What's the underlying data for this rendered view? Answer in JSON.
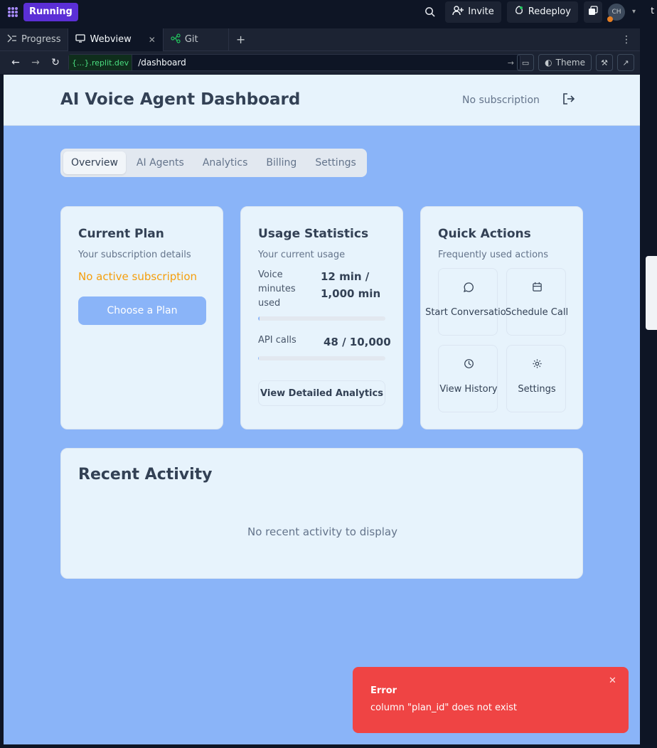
{
  "ide": {
    "status": "Running",
    "invite_label": "Invite",
    "redeploy_label": "Redeploy",
    "avatar_initials": "CH",
    "edge_letter": "t",
    "tabs": [
      {
        "label": "Progress",
        "icon": "progress-icon"
      },
      {
        "label": "Webview",
        "icon": "monitor-icon",
        "active": true
      },
      {
        "label": "Git",
        "icon": "git-branch-icon"
      }
    ],
    "url_host": "{...}.replit.dev",
    "url_path": "/dashboard",
    "theme_label": "Theme"
  },
  "app": {
    "title": "AI Voice Agent Dashboard",
    "subscription_status": "No subscription",
    "tabs": [
      "Overview",
      "AI Agents",
      "Analytics",
      "Billing",
      "Settings"
    ],
    "active_tab": "Overview"
  },
  "plan_card": {
    "title": "Current Plan",
    "subtitle": "Your subscription details",
    "status": "No active subscription",
    "button": "Choose a Plan"
  },
  "usage_card": {
    "title": "Usage Statistics",
    "subtitle": "Your current usage",
    "voice_label": "Voice minutes used",
    "voice_value": "12 min / 1,000 min",
    "voice_fraction": 0.012,
    "api_label": "API calls",
    "api_value": "48 / 10,000",
    "api_fraction": 0.0048,
    "button": "View Detailed Analytics"
  },
  "quick_actions": {
    "title": "Quick Actions",
    "subtitle": "Frequently used actions",
    "items": [
      {
        "label": "Start Conversation",
        "icon": "message-circle-icon"
      },
      {
        "label": "Schedule Call",
        "icon": "calendar-icon"
      },
      {
        "label": "View History",
        "icon": "clock-icon"
      },
      {
        "label": "Settings",
        "icon": "gear-icon"
      }
    ]
  },
  "activity": {
    "title": "Recent Activity",
    "empty": "No recent activity to display"
  },
  "toast": {
    "title": "Error",
    "message": "column \"plan_id\" does not exist"
  },
  "colors": {
    "accent": "#8ab4f8",
    "card": "#e7f3fc",
    "warning": "#f59e0b",
    "error": "#ef4444",
    "ide_bg": "#0e1525",
    "run_pill": "#5b2fd6"
  }
}
